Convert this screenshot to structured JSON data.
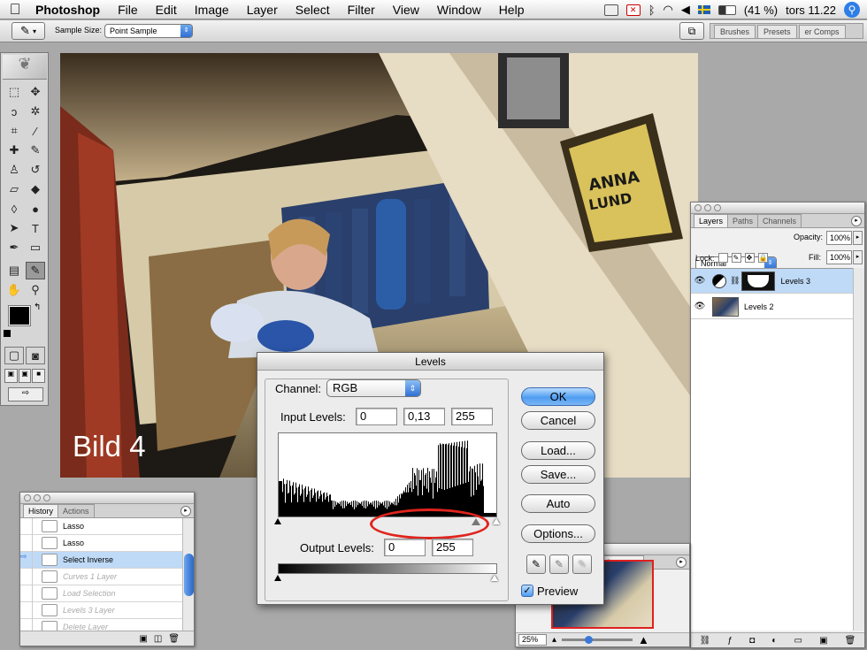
{
  "menubar": {
    "app": "Photoshop",
    "items": [
      "File",
      "Edit",
      "Image",
      "Layer",
      "Select",
      "Filter",
      "View",
      "Window",
      "Help"
    ],
    "status": {
      "battery": "(41 %)",
      "clock": "tors 11.22"
    }
  },
  "options": {
    "sample_size_label": "Sample Size:",
    "sample_size_value": "Point Sample",
    "well_tabs": [
      "Brushes",
      "Presets",
      "er Comps"
    ]
  },
  "document": {
    "caption": "Bild 4"
  },
  "history": {
    "tabs": [
      "History",
      "Actions"
    ],
    "items": [
      {
        "label": "Lasso",
        "state": "normal"
      },
      {
        "label": "Lasso",
        "state": "normal"
      },
      {
        "label": "Select Inverse",
        "state": "selected"
      },
      {
        "label": "Curves 1 Layer",
        "state": "dimmed"
      },
      {
        "label": "Load Selection",
        "state": "dimmed"
      },
      {
        "label": "Levels 3 Layer",
        "state": "dimmed"
      },
      {
        "label": "Delete Layer",
        "state": "dimmed"
      }
    ]
  },
  "layers": {
    "tabs": [
      "Layers",
      "Paths",
      "Channels"
    ],
    "blend_mode": "Normal",
    "opacity_label": "Opacity:",
    "opacity": "100%",
    "lock_label": "Lock:",
    "fill_label": "Fill:",
    "fill": "100%",
    "rows": [
      {
        "name": "Levels 3",
        "selected": true
      },
      {
        "name": "Levels 2",
        "selected": false
      }
    ]
  },
  "navigator": {
    "tab": "istogram",
    "zoom": "25%"
  },
  "levels": {
    "title": "Levels",
    "channel_label": "Channel:",
    "channel": "RGB",
    "input_label": "Input Levels:",
    "input_black": "0",
    "input_gamma": "0,13",
    "input_white": "255",
    "output_label": "Output Levels:",
    "output_black": "0",
    "output_white": "255",
    "buttons": {
      "ok": "OK",
      "cancel": "Cancel",
      "load": "Load...",
      "save": "Save...",
      "auto": "Auto",
      "options": "Options..."
    },
    "preview_label": "Preview",
    "preview_checked": true
  }
}
